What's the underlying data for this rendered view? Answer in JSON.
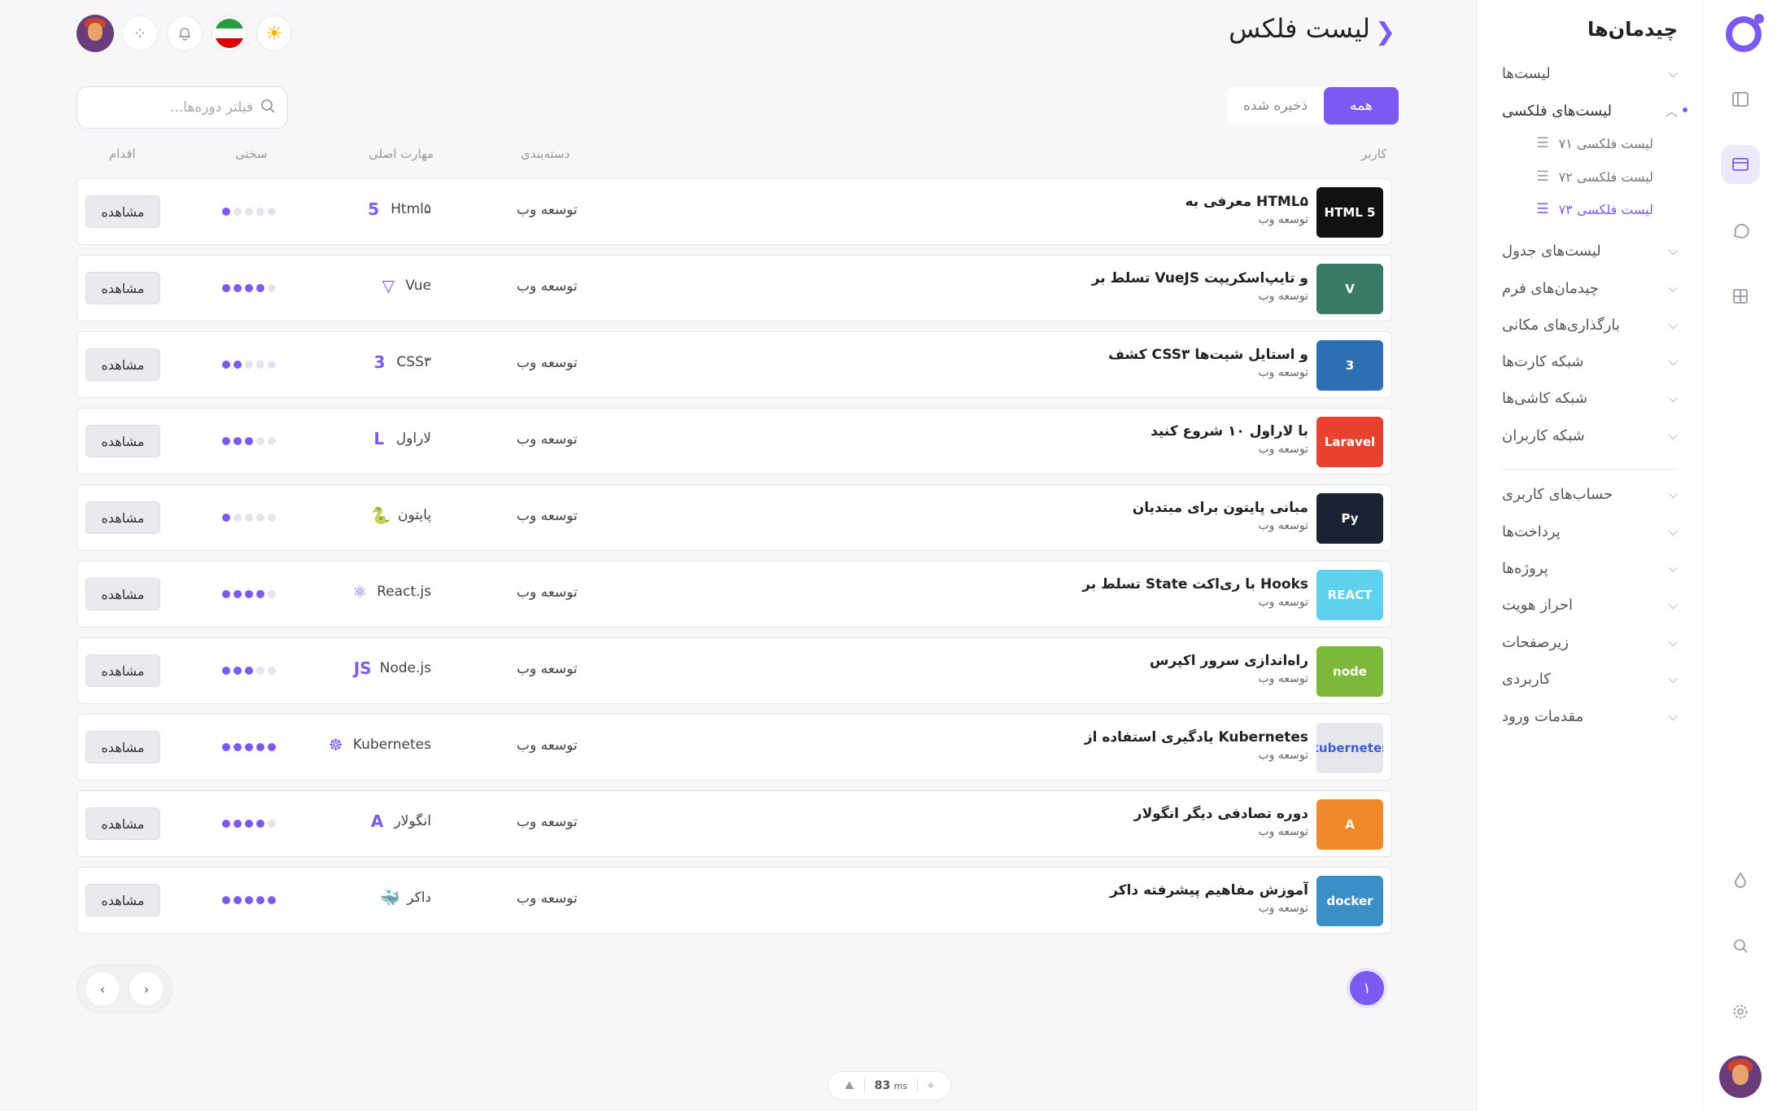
{
  "sidebar": {
    "title": "چیدمان‌ها",
    "items": [
      {
        "label": "لیست‌ها"
      },
      {
        "label": "لیست‌های فلکسی"
      },
      {
        "label": "لیست‌های جدول"
      },
      {
        "label": "چیدمان‌های فرم"
      },
      {
        "label": "بارگذاری‌های مکانی"
      },
      {
        "label": "شبکه کارت‌ها"
      },
      {
        "label": "شبکه کاشی‌ها"
      },
      {
        "label": "شبکه کاربران"
      },
      {
        "label": "حساب‌های کاربری"
      },
      {
        "label": "پرداخت‌ها"
      },
      {
        "label": "پروژه‌ها"
      },
      {
        "label": "احراز هویت"
      },
      {
        "label": "زیرصفحات"
      },
      {
        "label": "کاربردی"
      },
      {
        "label": "مقدمات ورود"
      }
    ],
    "subitems": [
      {
        "label": "لیست فلکسی ۷۱"
      },
      {
        "label": "لیست فلکسی ۷۲"
      },
      {
        "label": "لیست فلکسی ۷۳"
      }
    ]
  },
  "header": {
    "title": "لیست فلکس"
  },
  "tabs": [
    {
      "label": "همه"
    },
    {
      "label": "ذخیره شده"
    }
  ],
  "search": {
    "placeholder": "فیلتر دوره‌ها..."
  },
  "columns": {
    "user": "کاربر",
    "category": "دسته‌بندی",
    "skill": "مهارت اصلی",
    "difficulty": "سختی",
    "action": "اقدام"
  },
  "rows": [
    {
      "title": "معرفی به HTML۵",
      "subtitle": "توسعه وب",
      "category": "توسعه وب",
      "skill": "Html۵",
      "skill_icon": "html5-icon",
      "difficulty": 1,
      "action": "مشاهده",
      "thumb_label": "HTML 5",
      "thumb_color": "#111111"
    },
    {
      "title": "تسلط بر VueJS و تایپ‌اسکریپت",
      "subtitle": "توسعه وب",
      "category": "توسعه وب",
      "skill": "Vue",
      "skill_icon": "vue-icon",
      "difficulty": 4,
      "action": "مشاهده",
      "thumb_label": "V",
      "thumb_color": "#3c7a68"
    },
    {
      "title": "کشف CSS۳ و استایل شیت‌ها",
      "subtitle": "توسعه وب",
      "category": "توسعه وب",
      "skill": "CSS۳",
      "skill_icon": "css3-icon",
      "difficulty": 2,
      "action": "مشاهده",
      "thumb_label": "3",
      "thumb_color": "#2e6fb3"
    },
    {
      "title": "با لاراول ۱۰ شروع کنید",
      "subtitle": "توسعه وب",
      "category": "توسعه وب",
      "skill": "لاراول",
      "skill_icon": "laravel-icon",
      "difficulty": 3,
      "action": "مشاهده",
      "thumb_label": "Laravel",
      "thumb_color": "#e8412f"
    },
    {
      "title": "مبانی پایتون برای مبتدیان",
      "subtitle": "توسعه وب",
      "category": "توسعه وب",
      "skill": "پایتون",
      "skill_icon": "python-icon",
      "difficulty": 1,
      "action": "مشاهده",
      "thumb_label": "Py",
      "thumb_color": "#1b2333"
    },
    {
      "title": "تسلط بر State با ری‌اکت Hooks",
      "subtitle": "توسعه وب",
      "category": "توسعه وب",
      "skill": "React.js",
      "skill_icon": "react-icon",
      "difficulty": 4,
      "action": "مشاهده",
      "thumb_label": "REACT",
      "thumb_color": "#5fd1ef"
    },
    {
      "title": "راه‌اندازی سرور اکپرس",
      "subtitle": "توسعه وب",
      "category": "توسعه وب",
      "skill": "Node.js",
      "skill_icon": "nodejs-icon",
      "difficulty": 3,
      "action": "مشاهده",
      "thumb_label": "node",
      "thumb_color": "#7cb83a"
    },
    {
      "title": "یادگیری استفاده از Kubernetes",
      "subtitle": "توسعه وب",
      "category": "توسعه وب",
      "skill": "Kubernetes",
      "skill_icon": "kubernetes-icon",
      "difficulty": 5,
      "action": "مشاهده",
      "thumb_label": "kubernetes",
      "thumb_color": "#e6e6ec"
    },
    {
      "title": "دوره تصادفی دیگر انگولار",
      "subtitle": "توسعه وب",
      "category": "توسعه وب",
      "skill": "انگولار",
      "skill_icon": "angular-icon",
      "difficulty": 4,
      "action": "مشاهده",
      "thumb_label": "A",
      "thumb_color": "#f08a2a"
    },
    {
      "title": "آموزش مفاهیم پیشرفته داکر",
      "subtitle": "توسعه وب",
      "category": "توسعه وب",
      "skill": "داکر",
      "skill_icon": "docker-icon",
      "difficulty": 5,
      "action": "مشاهده",
      "thumb_label": "docker",
      "thumb_color": "#3a8fc7"
    }
  ],
  "pagination": {
    "current": "۱"
  },
  "status": {
    "ms": "83",
    "unit": "ms"
  },
  "colors": {
    "accent": "#7c5af2"
  }
}
